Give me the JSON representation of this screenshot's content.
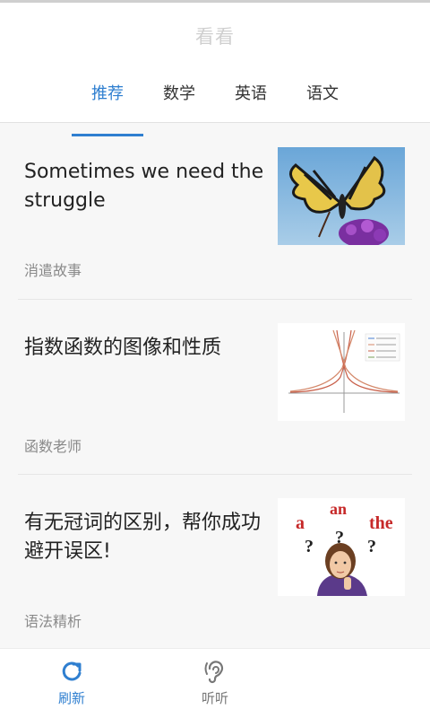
{
  "header": {
    "title": "看看"
  },
  "tabs": [
    {
      "label": "推荐",
      "active": true
    },
    {
      "label": "数学",
      "active": false
    },
    {
      "label": "英语",
      "active": false
    },
    {
      "label": "语文",
      "active": false
    }
  ],
  "feed": [
    {
      "title": "Sometimes we need the struggle",
      "source": "消遣故事",
      "image": "butterfly-photo"
    },
    {
      "title": "指数函数的图像和性质",
      "source": "函数老师",
      "image": "exponential-graph"
    },
    {
      "title": "有无冠词的区别，帮你成功避开误区!",
      "source": "语法精析",
      "image": "article-question-girl",
      "image_text": [
        "a",
        "an",
        "the",
        "?",
        "?",
        "?"
      ]
    }
  ],
  "bottom_nav": [
    {
      "label": "刷新",
      "icon": "refresh-icon",
      "active": true
    },
    {
      "label": "听听",
      "icon": "ear-icon",
      "active": false
    }
  ],
  "colors": {
    "accent": "#2f7fd0",
    "title_gray": "#cfcfcf"
  }
}
